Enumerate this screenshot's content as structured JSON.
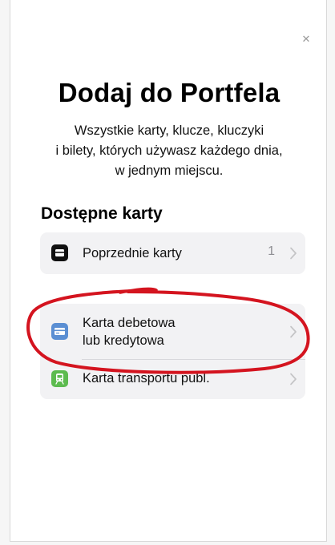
{
  "header": {
    "title": "Dodaj do Portfela",
    "subtitle_lines": [
      "Wszystkie karty, klucze, kluczyki",
      "i bilety, których używasz każdego dnia,",
      "w jednym miejscu."
    ],
    "close_icon": "close-icon"
  },
  "section": {
    "title": "Dostępne karty"
  },
  "cards": {
    "previous": {
      "label": "Poprzednie karty",
      "count": "1",
      "icon": "wallet-icon",
      "icon_color": "#111111"
    },
    "debit": {
      "label_lines": [
        "Karta debetowa",
        "lub kredytowa"
      ],
      "icon": "credit-card-icon",
      "icon_color": "#5b8fd3"
    },
    "transit": {
      "label": "Karta transportu publ.",
      "icon": "train-icon",
      "icon_color": "#5dbb4f"
    }
  },
  "annotation": {
    "type": "hand-drawn circle",
    "color": "#d4141f"
  },
  "colors": {
    "group_bg": "#f2f2f4",
    "chevron": "#c4c4c6",
    "secondary_text": "#8e8e93"
  }
}
